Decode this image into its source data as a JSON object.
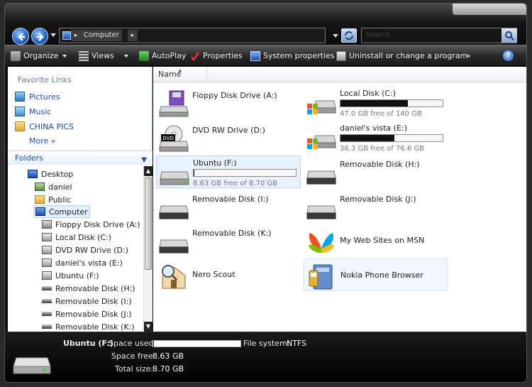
{
  "address": {
    "crumbs": [
      "Computer"
    ]
  },
  "search": {
    "placeholder": "Search"
  },
  "toolbar": {
    "organize": "Organize",
    "views": "Views",
    "autoplay": "AutoPlay",
    "properties": "Properties",
    "system_properties": "System properties",
    "uninstall": "Uninstall or change a program",
    "more": "»",
    "help": "?"
  },
  "favorites": {
    "title": "Favorite Links",
    "items": [
      {
        "label": "Pictures"
      },
      {
        "label": "Music"
      },
      {
        "label": "CHINA PICS"
      },
      {
        "label": "More  »"
      }
    ]
  },
  "folders": {
    "title": "Folders",
    "tree": [
      {
        "label": "Desktop"
      },
      {
        "label": "daniel"
      },
      {
        "label": "Public"
      },
      {
        "label": "Computer"
      },
      {
        "label": "Floppy Disk Drive (A:)"
      },
      {
        "label": "Local Disk (C:)"
      },
      {
        "label": "DVD RW Drive (D:)"
      },
      {
        "label": "daniel's vista (E:)"
      },
      {
        "label": "Ubuntu (F:)"
      },
      {
        "label": "Removable Disk (H:)"
      },
      {
        "label": "Removable Disk (I:)"
      },
      {
        "label": "Removable Disk (J:)"
      },
      {
        "label": "Removable Disk (K:)"
      }
    ]
  },
  "content": {
    "column_name": "Name",
    "items": [
      {
        "name": "Floppy Disk Drive (A:)"
      },
      {
        "name": "Local Disk (C:)",
        "free": "47.0 GB free of 140 GB",
        "used_fraction": 0.66
      },
      {
        "name": "DVD RW Drive (D:)",
        "badge": "DVD"
      },
      {
        "name": "daniel's vista (E:)",
        "free": "36.3 GB free of 76.6 GB",
        "used_fraction": 0.53
      },
      {
        "name": "Ubuntu (F:)",
        "free": "8.63 GB free of 8.70 GB",
        "used_fraction": 0.01
      },
      {
        "name": "Removable Disk (H:)"
      },
      {
        "name": "Removable Disk (I:)"
      },
      {
        "name": "Removable Disk (J:)"
      },
      {
        "name": "Removable Disk (K:)"
      },
      {
        "name": "My Web Sites on MSN"
      },
      {
        "name": "Nero Scout"
      },
      {
        "name": "Nokia Phone Browser"
      }
    ]
  },
  "details": {
    "name": "Ubuntu (F:)",
    "space_used_label": "Space used:",
    "space_used_fraction": 0.01,
    "file_system_label": "File system:",
    "file_system": "NTFS",
    "space_free_label": "Space free:",
    "space_free": "8.63 GB",
    "total_size_label": "Total size:",
    "total_size": "8.70 GB"
  }
}
